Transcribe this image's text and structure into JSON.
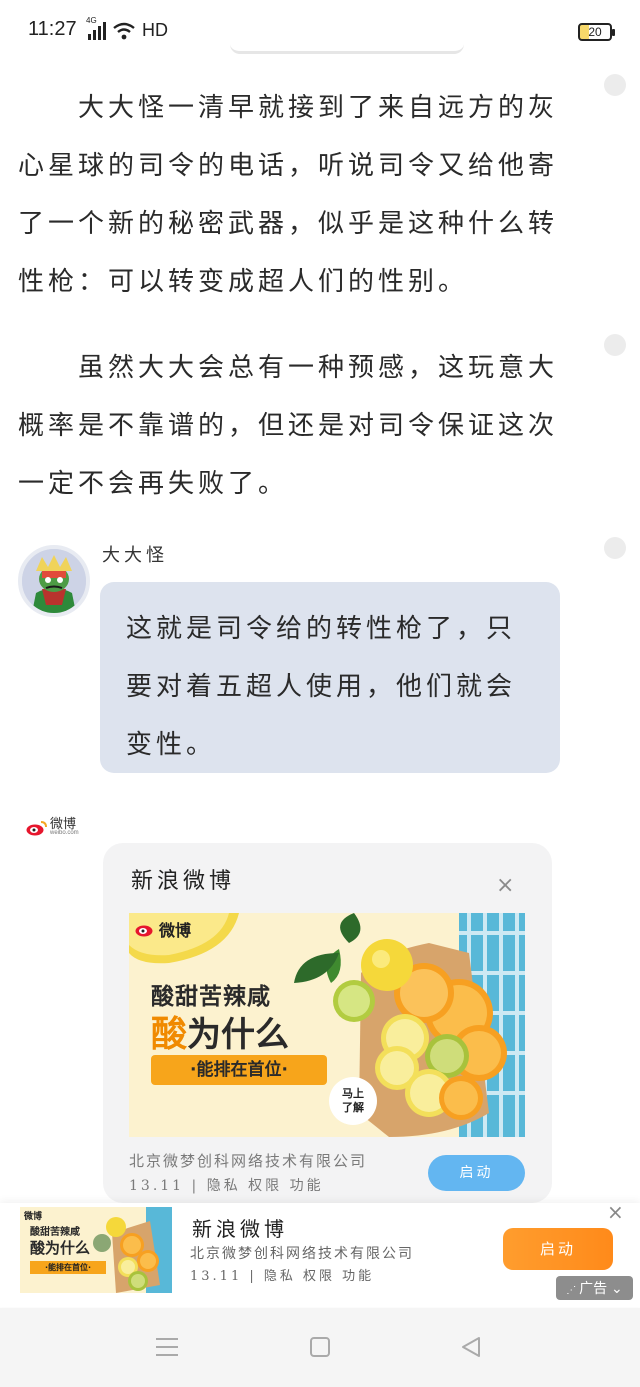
{
  "status_bar": {
    "time": "11:27",
    "network": "4G",
    "hd": "HD",
    "battery": "20"
  },
  "story": {
    "paragraphs": [
      "大大怪一清早就接到了来自远方的灰心星球的司令的电话，听说司令又给他寄了一个新的秘密武器，似乎是这种什么转性枪：可以转变成超人们的性别。",
      "虽然大大会总有一种预感，这玩意大概率是不靠谱的，但还是对司令保证这次一定不会再失败了。"
    ],
    "chat": {
      "speaker": "大大怪",
      "message": "这就是司令给的转性枪了，只要对着五超人使用，他们就会变性。"
    }
  },
  "ad_card": {
    "source_logo_text": "微博",
    "source_logo_sub": "weibo.com",
    "title": "新浪微博",
    "close": "×",
    "image": {
      "brand": "微博",
      "headline_small": "酸甜苦辣咸",
      "headline_big_1": "酸",
      "headline_big_2": "为什么",
      "tagline": "·能排在首位·",
      "stamp": "马上了解"
    },
    "company": "北京微梦创科网络技术有限公司",
    "meta": "13.11 | 隐私  权限  功能",
    "start_label": "启动"
  },
  "bottom_banner": {
    "title": "新浪微博",
    "company": "北京微梦创科网络技术有限公司",
    "meta": "13.11 | 隐私  权限  功能",
    "start_label": "启动",
    "close": "×",
    "ad_badge": "广告",
    "image": {
      "brand": "微博",
      "headline_small": "酸甜苦辣咸",
      "headline_big": "酸为什么",
      "tagline": "·能排在首位·"
    }
  },
  "colors": {
    "bubble": "#dde3ee",
    "ad_start_blue": "#63b6f1",
    "banner_start_orange": "#ff9230",
    "weibo_red": "#e6162d"
  },
  "icons": [
    "signal-icon",
    "wifi-icon",
    "battery-icon",
    "weibo-logo-icon",
    "close-icon",
    "menu-nav-icon",
    "home-nav-icon",
    "back-nav-icon"
  ]
}
